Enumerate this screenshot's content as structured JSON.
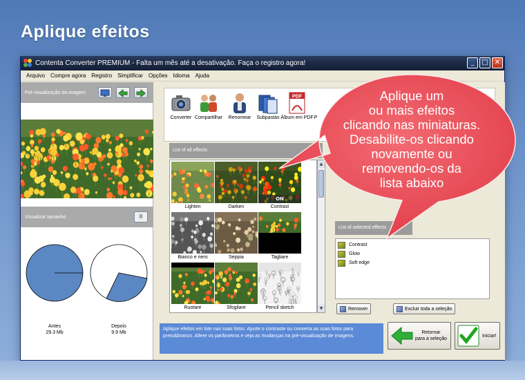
{
  "slide": {
    "title": "Aplique efeitos"
  },
  "window": {
    "title": "Contenta Converter PREMIUM  - Falta um mês até a desativação. Faça o registro agora!",
    "controls": {
      "minimize": "_",
      "maximize": "□",
      "close": "✕"
    }
  },
  "menu": [
    "Arquivo",
    "Compre agora",
    "Registro",
    "Simplificar",
    "Opções",
    "Idioma",
    "Ajuda"
  ],
  "preview": {
    "header": "Pré-visualização da imagem"
  },
  "size": {
    "header": "Visualizar tamanho",
    "pause_label": "II",
    "before_label": "Antes",
    "before_value": "29.3 Mb",
    "after_label": "Depois",
    "after_value": "9.9 Mb",
    "after_fraction": 0.34
  },
  "toolbar": {
    "items": [
      {
        "label": "Converter",
        "icon": "camera-icon"
      },
      {
        "label": "Compartilhar",
        "icon": "people-icon"
      },
      {
        "label": "Renomear",
        "icon": "person-icon"
      },
      {
        "label": "Subpastas",
        "icon": "folders-icon"
      },
      {
        "label": "Álbum em PDF",
        "icon": "pdf-icon"
      },
      {
        "label": "P",
        "icon": "partial-icon"
      }
    ]
  },
  "effects": {
    "header": "List of all effects",
    "items": [
      {
        "label": "Lighten",
        "state": ""
      },
      {
        "label": "Darken",
        "state": ""
      },
      {
        "label": "Contrast",
        "state": "ON"
      },
      {
        "label": "Bianco e nero",
        "state": ""
      },
      {
        "label": "Seppia",
        "state": ""
      },
      {
        "label": "Tagliare",
        "state": ""
      },
      {
        "label": "Ruotare",
        "state": ""
      },
      {
        "label": "Sfogliare",
        "state": ""
      },
      {
        "label": "Pencil sketch",
        "state": ""
      }
    ]
  },
  "selected": {
    "header": "List of selected effects",
    "items": [
      "Contrast",
      "Glow",
      "Soft edge"
    ],
    "remove_label": "Remover",
    "clear_label": "Excluir toda a seleção"
  },
  "info": {
    "text": "Aplique efeitos em lote nas suas fotos. Ajuste o contraste ou converta as suas fotos para preto&branco. Altere os parâmetros e veja as mudanças na pré-visualização de imagens."
  },
  "actions": {
    "back_line1": "Retornar",
    "back_line2": "para a seleção",
    "start_label": "Iniciar!"
  },
  "callout": {
    "lines": [
      "Aplique um",
      "ou mais efeitos",
      "clicando nas miniaturas.",
      "Desabilite-os clicando",
      "novamente ou",
      "removendo-os da",
      "lista abaixo"
    ]
  },
  "colors": {
    "callout": "#f0505a",
    "info_box": "#5b8ad6",
    "pie_fill": "#5b87c2",
    "titlebar": "#1c2944"
  }
}
